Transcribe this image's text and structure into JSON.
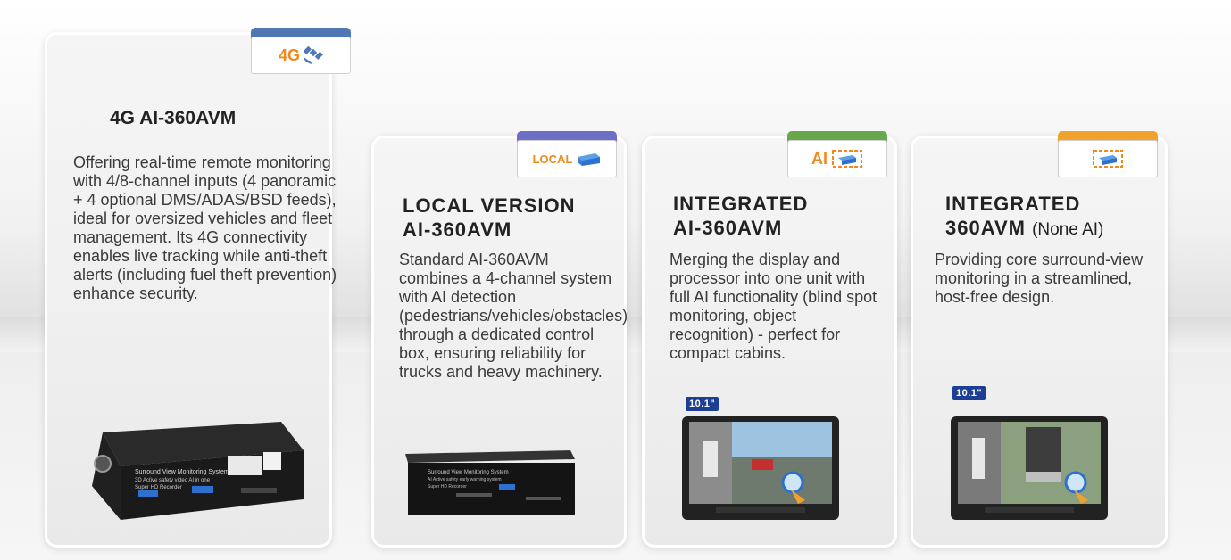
{
  "cards": [
    {
      "tab_label": "4G",
      "title_line1": "4G AI-360AVM",
      "description": "Offering real-time remote monitoring with 4/8-channel inputs (4 panoramic + 4 optional DMS/ADAS/BSD feeds), ideal for oversized vehicles and fleet management. Its 4G connectivity enables live tracking while anti-theft alerts (including fuel theft prevention) enhance security.",
      "device_lines": [
        "Surround View Monitoring System",
        "3D Active safety video AI in one",
        "Super HD Recorder"
      ]
    },
    {
      "tab_label": "LOCAL",
      "title_line1": "LOCAL VERSION",
      "title_line2": "AI-360AVM",
      "description": "Standard AI-360AVM combines a 4-channel system with AI detection (pedestrians/vehicles/obstacles) through a dedicated control box, ensuring reliability for trucks and heavy machinery.",
      "device_lines": [
        "Surround View Monitoring System",
        "AI Active safety early warning system",
        "Super HD Recorder"
      ]
    },
    {
      "tab_label": "AI",
      "title_line1": "INTEGRATED",
      "title_line2": "AI-360AVM",
      "description": "Merging the display and processor into one unit with full AI functionality (blind spot monitoring, object recognition) - perfect for compact cabins.",
      "badge": "10.1\""
    },
    {
      "title_line1": "INTEGRATED",
      "title_line2": "360AVM",
      "title_suffix": "(None AI)",
      "description": "Providing core surround-view monitoring in a streamlined, host-free design.",
      "badge": "10.1\""
    }
  ],
  "colors": {
    "tab_4g": "#4f77b4",
    "tab_local": "#6d6fc4",
    "tab_ai": "#66a84a",
    "tab_none_ai": "#f0a22d",
    "accent": "#f08a1c",
    "badge": "#1c3f93"
  }
}
